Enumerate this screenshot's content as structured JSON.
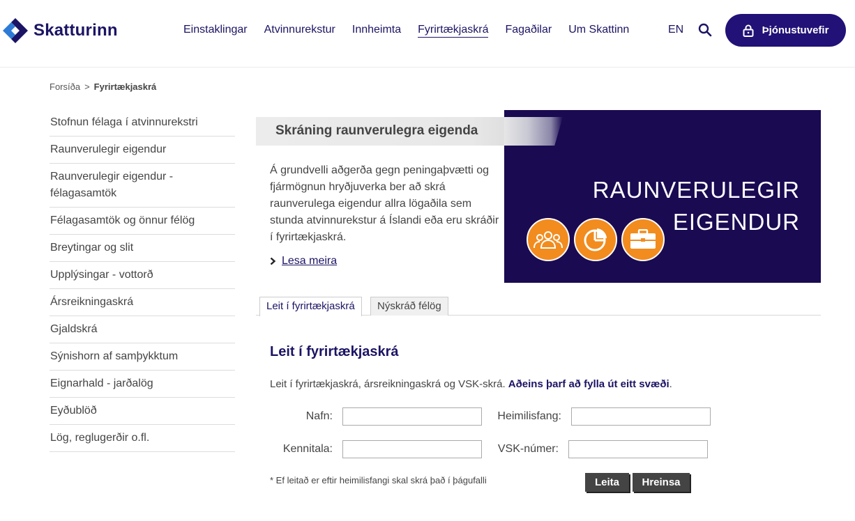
{
  "header": {
    "logo_text": "Skatturinn",
    "nav": [
      {
        "label": "Einstaklingar"
      },
      {
        "label": "Atvinnurekstur"
      },
      {
        "label": "Innheimta"
      },
      {
        "label": "Fyrirtækjaskrá"
      },
      {
        "label": "Fagaðilar"
      },
      {
        "label": "Um Skattinn"
      }
    ],
    "active_nav": "Fyrirtækjaskrá",
    "lang": "EN",
    "service_button": "Þjónustuvefir"
  },
  "breadcrumb": {
    "home": "Forsíða",
    "separator": ">",
    "current": "Fyrirtækjaskrá"
  },
  "sidebar": {
    "items": [
      {
        "label": "Stofnun félaga í atvinnurekstri"
      },
      {
        "label": "Raunverulegir eigendur"
      },
      {
        "label": "Raunverulegir eigendur - félagasamtök"
      },
      {
        "label": "Félagasamtök og önnur félög"
      },
      {
        "label": "Breytingar og slit"
      },
      {
        "label": "Upplýsingar - vottorð"
      },
      {
        "label": "Ársreikningaskrá"
      },
      {
        "label": "Gjaldskrá"
      },
      {
        "label": "Sýnishorn af samþykktum"
      },
      {
        "label": "Eignarhald - jarðalög"
      },
      {
        "label": "Eyðublöð"
      },
      {
        "label": "Lög, reglugerðir o.fl."
      }
    ]
  },
  "hero": {
    "label": "Skráning raunverulegra eigenda",
    "text": "Á grundvelli aðgerða gegn peningaþvætti og fjármögnun hryðjuverka ber að skrá raunverulega eigendur allra lögaðila sem stunda atvinnurekstur á Íslandi eða eru skráðir í fyrirtækjaskrá.",
    "more_link": "Lesa meira",
    "image_title_line1": "RAUNVERULEGIR",
    "image_title_line2": "EIGENDUR",
    "accent_color": "#f28c1e",
    "image_bg": "#1a0a52"
  },
  "tabs": [
    {
      "label": "Leit í fyrirtækjaskrá",
      "active": true
    },
    {
      "label": "Nýskráð félög",
      "active": false
    }
  ],
  "search": {
    "title": "Leit í fyrirtækjaskrá",
    "desc_plain": "Leit í fyrirtækjaskrá, ársreikningaskrá og VSK-skrá. ",
    "desc_strong": "Aðeins þarf að fylla út eitt svæði",
    "desc_end": ".",
    "fields": {
      "name_label": "Nafn:",
      "name_value": "",
      "address_label": "Heimilisfang:",
      "address_value": "",
      "kennitala_label": "Kennitala:",
      "kennitala_value": "",
      "vsk_label": "VSK-númer:",
      "vsk_value": ""
    },
    "note": "* Ef leitað er eftir heimilisfangi skal skrá það í þágufalli",
    "search_button": "Leita",
    "clear_button": "Hreinsa"
  },
  "colors": {
    "brand": "#1b1464",
    "service_button": "#221177"
  }
}
